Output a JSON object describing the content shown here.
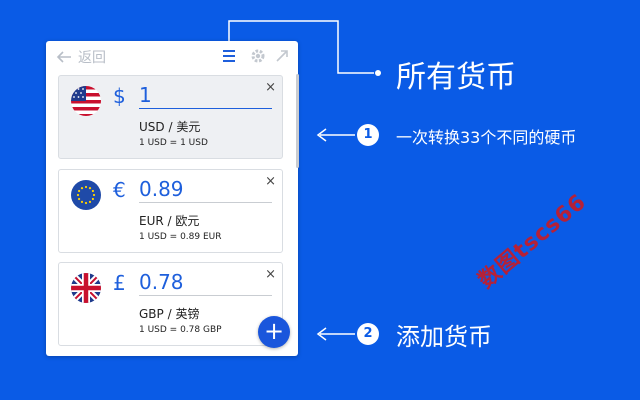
{
  "toolbar": {
    "back_label": "返回"
  },
  "cards": [
    {
      "symbol": "$",
      "amount": "1",
      "currency_label": "USD / 美元",
      "rate": "1 USD = 1 USD",
      "flag": "us-flag-icon",
      "close": "×"
    },
    {
      "symbol": "€",
      "amount": "0.89",
      "currency_label": "EUR / 欧元",
      "rate": "1 USD = 0.89 EUR",
      "flag": "eu-flag-icon",
      "close": "×"
    },
    {
      "symbol": "£",
      "amount": "0.78",
      "currency_label": "GBP / 英镑",
      "rate": "1 USD = 0.78 GBP",
      "flag": "uk-flag-icon",
      "close": "×"
    }
  ],
  "fab": {
    "label": "+"
  },
  "callouts": {
    "title": "所有货币",
    "step1": {
      "number": "1",
      "text": "一次转换33个不同的硬币"
    },
    "step2": {
      "number": "2",
      "text": "添加货币"
    }
  },
  "watermark": "数图tscs66",
  "colors": {
    "background": "#0a5be6",
    "accent": "#1e5fdc",
    "watermark": "#c41d2a"
  }
}
